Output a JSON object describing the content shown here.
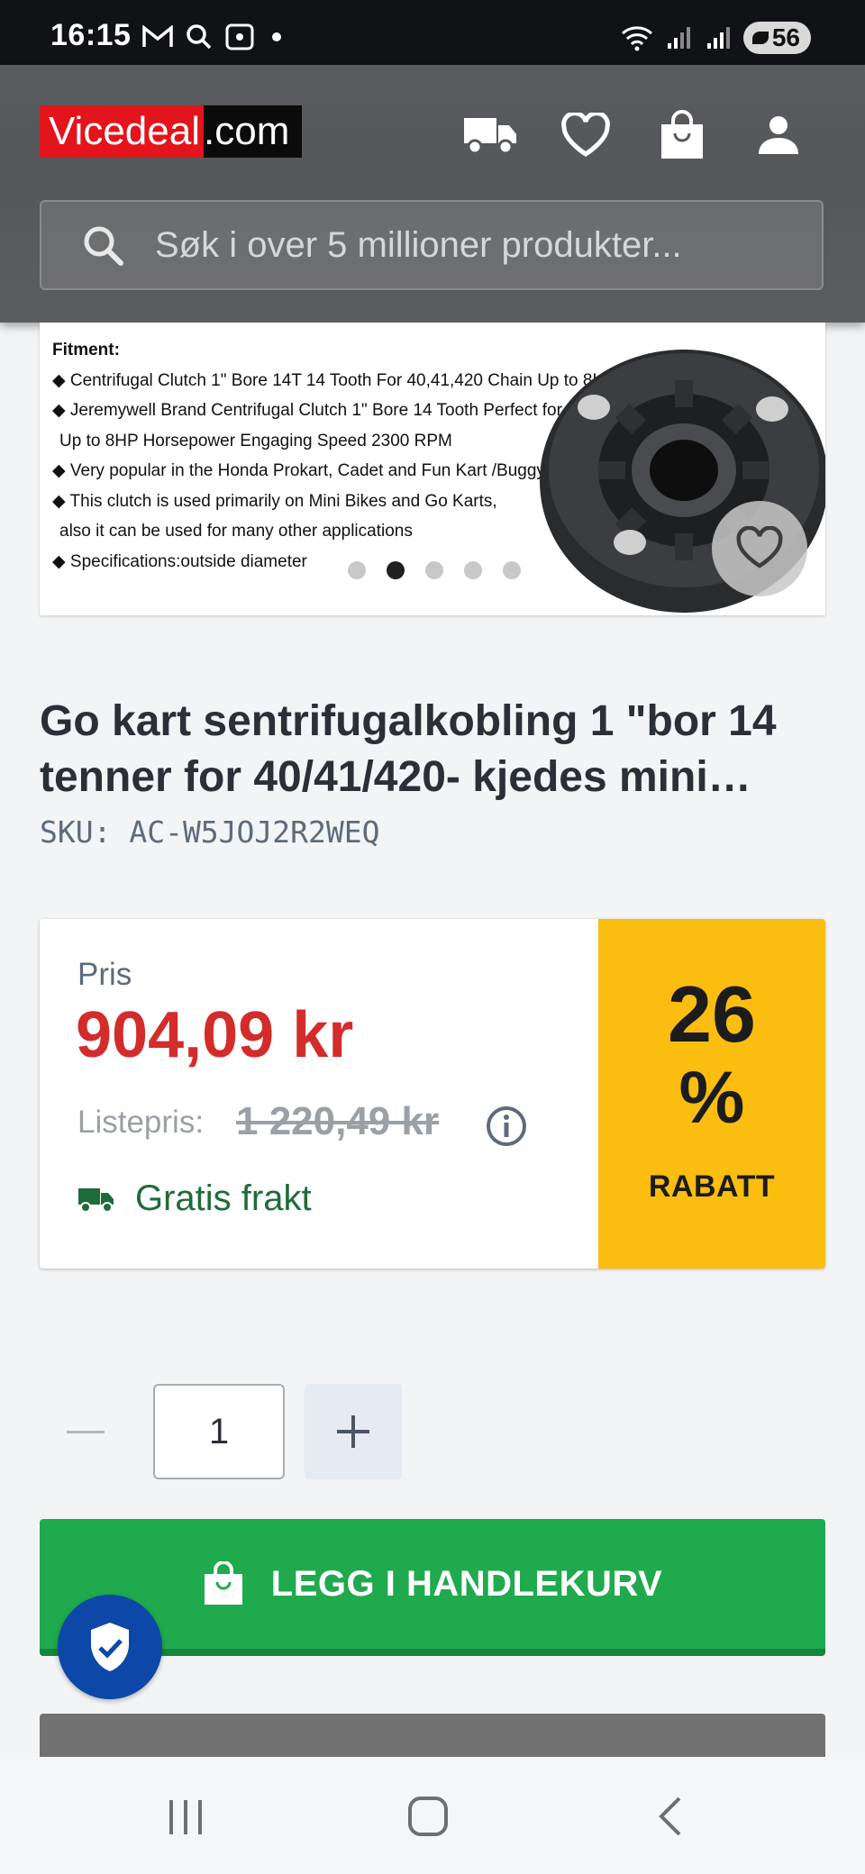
{
  "status_bar": {
    "time": "16:15",
    "battery": "56"
  },
  "header": {
    "logo_part1": "Vicedeal",
    "logo_part2": ".com",
    "search_placeholder": "Søk i over 5 millioner produkter..."
  },
  "product_image": {
    "lines": [
      "Fitment:",
      "◆ Centrifugal Clutch 1\" Bore 14T 14 Tooth For 40,41,420 Chain Up to 8HP, 2300 RPM",
      "◆ Jeremywell Brand Centrifugal Clutch 1\" Bore 14 Tooth Perfect for 40-41-420 Roller Chain",
      "   Up to 8HP Horsepower Engaging Speed 2300 RPM",
      "◆ Very popular in the Honda Prokart, Cadet and Fun Kart /Buggy Market",
      "◆ This clutch is used primarily on Mini Bikes and Go Karts,",
      "   also it can be used for many other applications",
      "◆ Specifications:outside diameter"
    ],
    "slide_count": 5,
    "active_slide": 2
  },
  "product": {
    "title": "Go kart sentrifugalkobling 1 \"bor 14 tenner for 40/41/420- kjedes mini…",
    "sku": "SKU: AC-W5JOJ2R2WEQ"
  },
  "pricing": {
    "price_label": "Pris",
    "price": "904,09 kr",
    "list_label": "Listepris:",
    "list_price": "1 220,49 kr",
    "shipping": "Gratis frakt",
    "discount_number": "26",
    "discount_percent": "%",
    "discount_label": "RABATT",
    "discount_color": "#fbbd0f",
    "price_color": "#d42b2b"
  },
  "quantity": {
    "value": "1"
  },
  "cart": {
    "button_label": "LEGG I HANDLEKURV",
    "button_color": "#1faa4d"
  }
}
